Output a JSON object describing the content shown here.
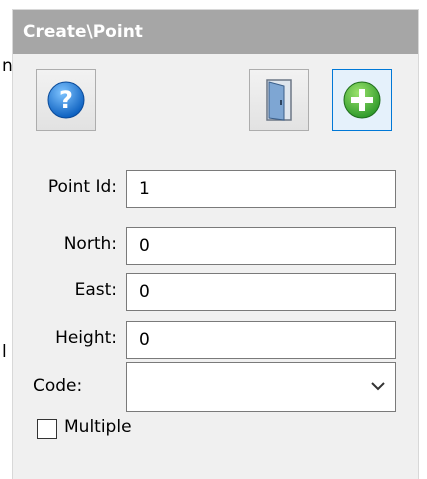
{
  "stray_text": {
    "top": "n",
    "bottom": "l"
  },
  "window": {
    "title": "Create\\Point"
  },
  "toolbar": {
    "help_icon": "question-mark-icon",
    "exit_icon": "door-icon",
    "add_icon": "plus-circle-icon",
    "accent": "#0078d7"
  },
  "form": {
    "point_id": {
      "label": "Point Id:",
      "value": "1"
    },
    "north": {
      "label": "North:",
      "value": "0"
    },
    "east": {
      "label": "East:",
      "value": "0"
    },
    "height": {
      "label": "Height:",
      "value": "0"
    },
    "code": {
      "label": "Code:",
      "value": ""
    },
    "multiple": {
      "label": "Multiple",
      "checked": false
    }
  }
}
